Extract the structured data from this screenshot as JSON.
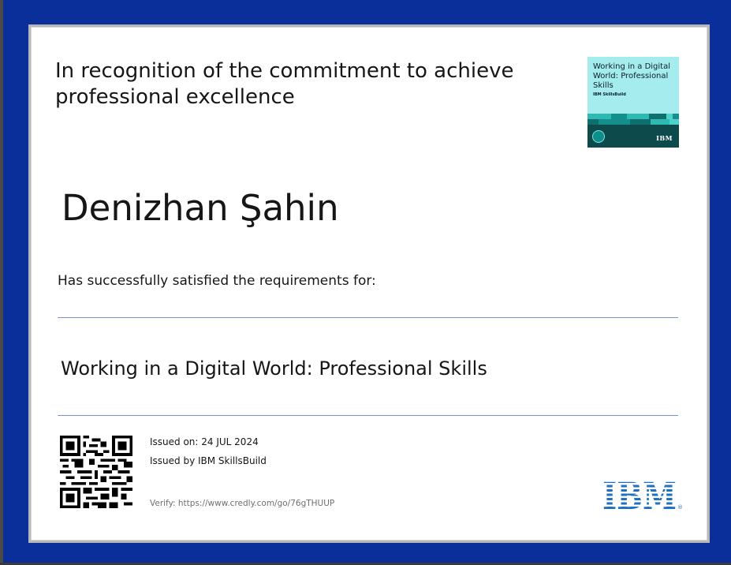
{
  "certificate": {
    "headline": "In recognition of the commitment to achieve professional excellence",
    "recipient_name": "Denizhan Şahin",
    "requirements_text": "Has successfully satisfied the requirements for:",
    "course_title": "Working in a Digital World: Professional Skills",
    "issued_on": "Issued on: 24 JUL 2024",
    "issued_by": "Issued by IBM SkillsBuild",
    "verify": "Verify: https://www.credly.com/go/76gTHUUP"
  },
  "badge": {
    "title": "Working in a Digital World: Professional Skills",
    "brand": "IBM SkillsBuild",
    "logo": "IBM"
  },
  "footer": {
    "logo": "IBM"
  },
  "colors": {
    "page_background": "#0a2f9a",
    "rule": "#7c8fd0",
    "ibm_blue": "#1f70c1",
    "badge_cyan": "#a4ecee",
    "badge_teal": "#0c4a4c"
  },
  "icons": [
    "qr-code",
    "ibm-logo",
    "badge-icon"
  ]
}
